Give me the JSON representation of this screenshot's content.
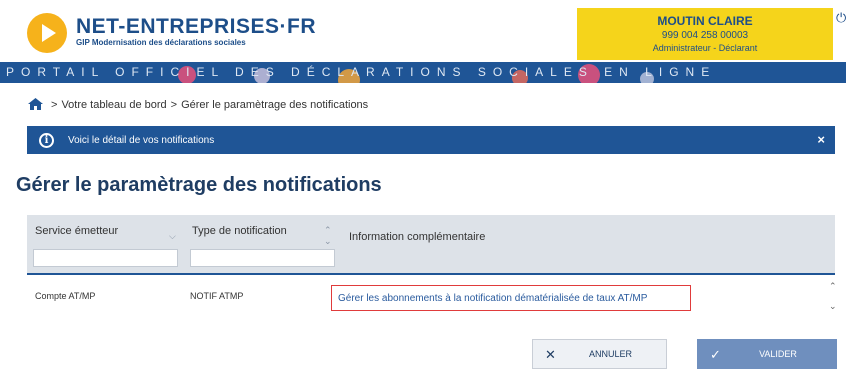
{
  "header": {
    "logo_name": "NET-ENTREPRISES·FR",
    "logo_subtitle": "GIP Modernisation des déclarations sociales",
    "user": {
      "name": "MOUTIN CLAIRE",
      "id": "999 004 258 00003",
      "role": "Administrateur - Déclarant"
    },
    "power_icon": "power-icon"
  },
  "banner": {
    "text": "PORTAIL OFFICIEL DES DÉCLARATIONS SOCIALES EN LIGNE"
  },
  "breadcrumb": {
    "home_icon": "home-icon",
    "items": [
      "Votre tableau de bord",
      "Gérer le paramètrage des notifications"
    ]
  },
  "alert": {
    "text": "Voici le détail de vos notifications",
    "icon": "info-icon",
    "close": "×"
  },
  "page": {
    "title": "Gérer le paramètrage des notifications"
  },
  "table": {
    "columns": [
      "Service émetteur",
      "Type de notification",
      "Information complémentaire"
    ],
    "filters": [
      {
        "placeholder": "",
        "value": ""
      },
      {
        "placeholder": "",
        "value": ""
      }
    ],
    "rows": [
      {
        "service": "Compte AT/MP",
        "type": "NOTIF ATMP",
        "info": "Gérer les abonnements à la notification dématérialisée de taux AT/MP"
      }
    ]
  },
  "buttons": {
    "cancel": "ANNULER",
    "validate": "VALIDER"
  },
  "colors": {
    "primary": "#1f5596",
    "accent_yellow": "#f5d41b",
    "logo_orange": "#f6b21b",
    "highlight_border": "#e03b3b"
  }
}
